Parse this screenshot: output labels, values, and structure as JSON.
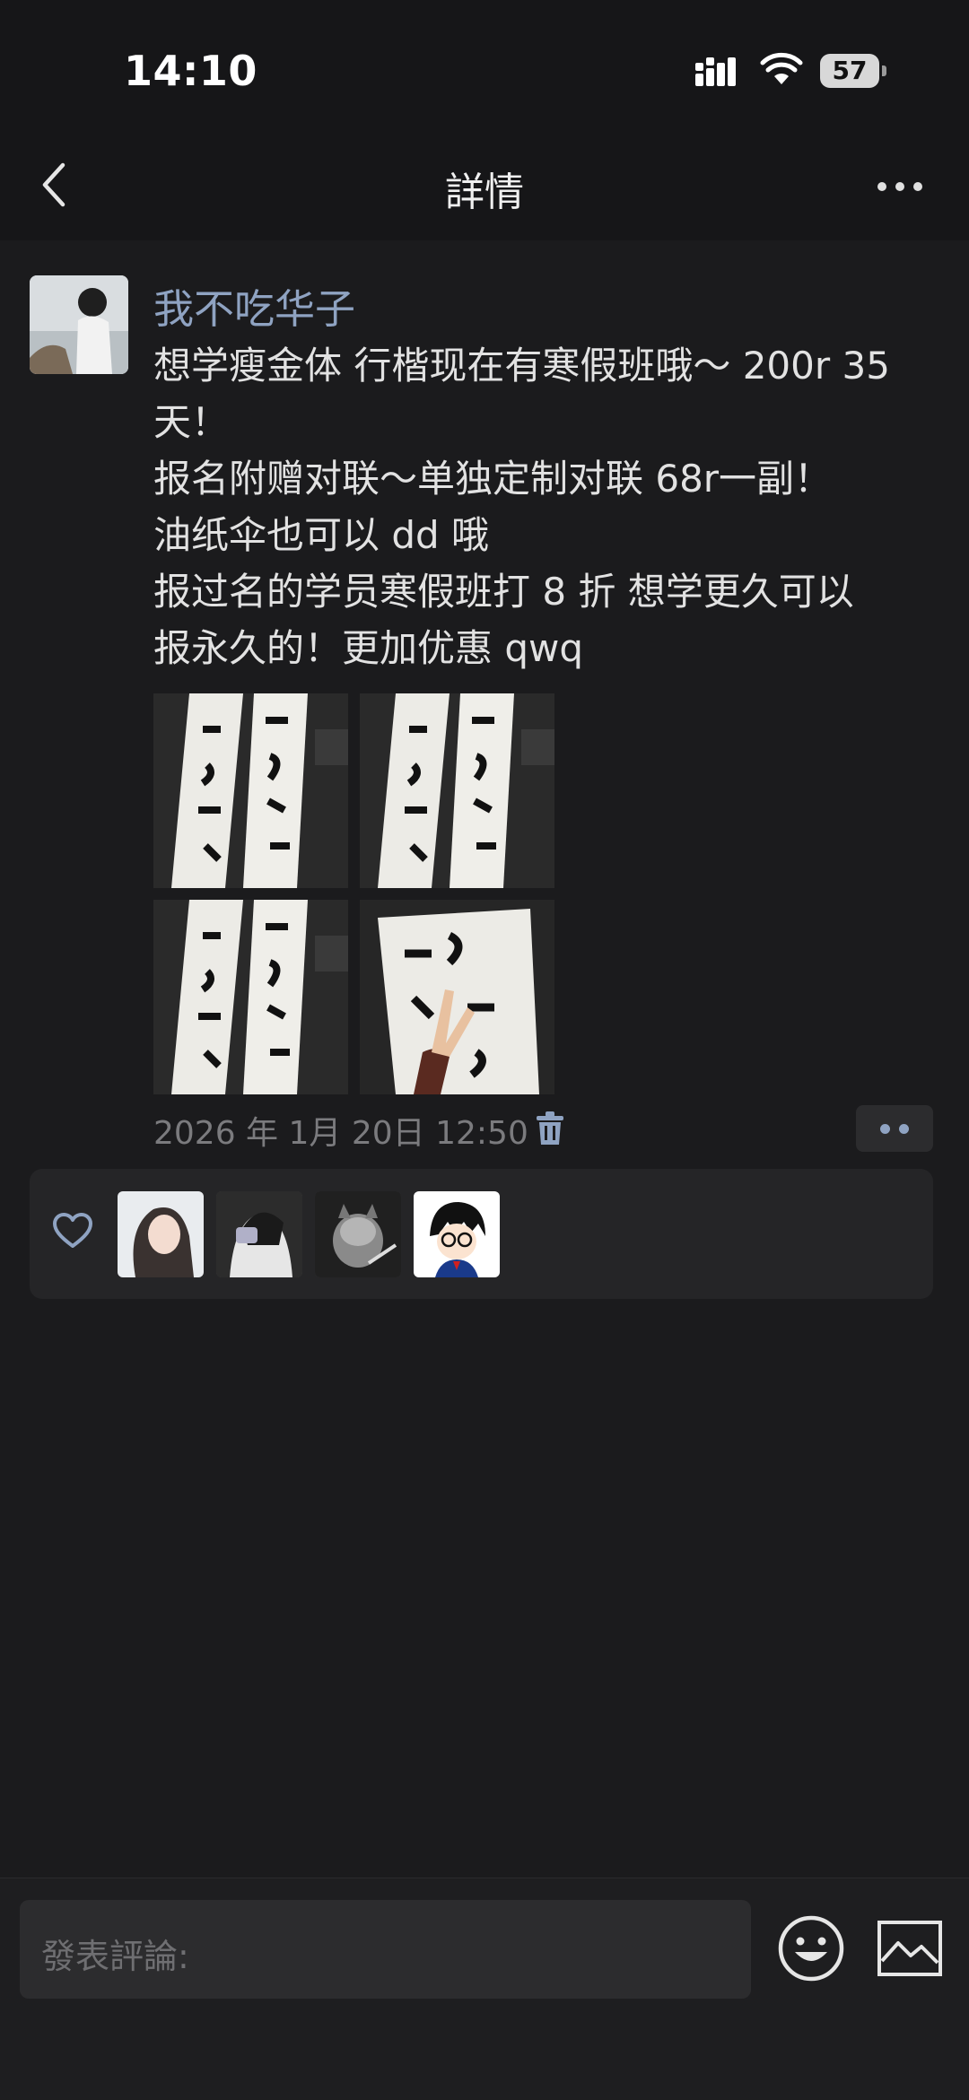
{
  "status_bar": {
    "time": "14:10",
    "battery": "57"
  },
  "nav": {
    "title": "詳情",
    "back_icon": "chevron-left-icon",
    "more_icon": "more-dots-icon"
  },
  "post": {
    "username": "我不吃华子",
    "text_lines": [
      "想学瘦金体 行楷现在有寒假班哦～ 200r 35",
      "天！",
      "报名附赠对联～单独定制对联 68r一副！",
      "油纸伞也可以 dd 哦",
      "报过名的学员寒假班打 8 折 想学更久可以",
      "报永久的！更加优惠 qwq"
    ],
    "photo_count": 4,
    "timestamp": "2026 年 1月 20日 12:50",
    "delete_icon": "trash-icon",
    "options_icon": "two-dots-icon"
  },
  "likes": {
    "icon": "heart-icon",
    "avatars": [
      "liker-avatar-1",
      "liker-avatar-2",
      "liker-avatar-3",
      "liker-avatar-4"
    ]
  },
  "comment_bar": {
    "placeholder": "發表評論:",
    "emoji_icon": "emoji-icon",
    "image_icon": "image-icon"
  },
  "colors": {
    "background": "#1b1b1d",
    "username": "#8fa3c2",
    "card": "#252527"
  }
}
